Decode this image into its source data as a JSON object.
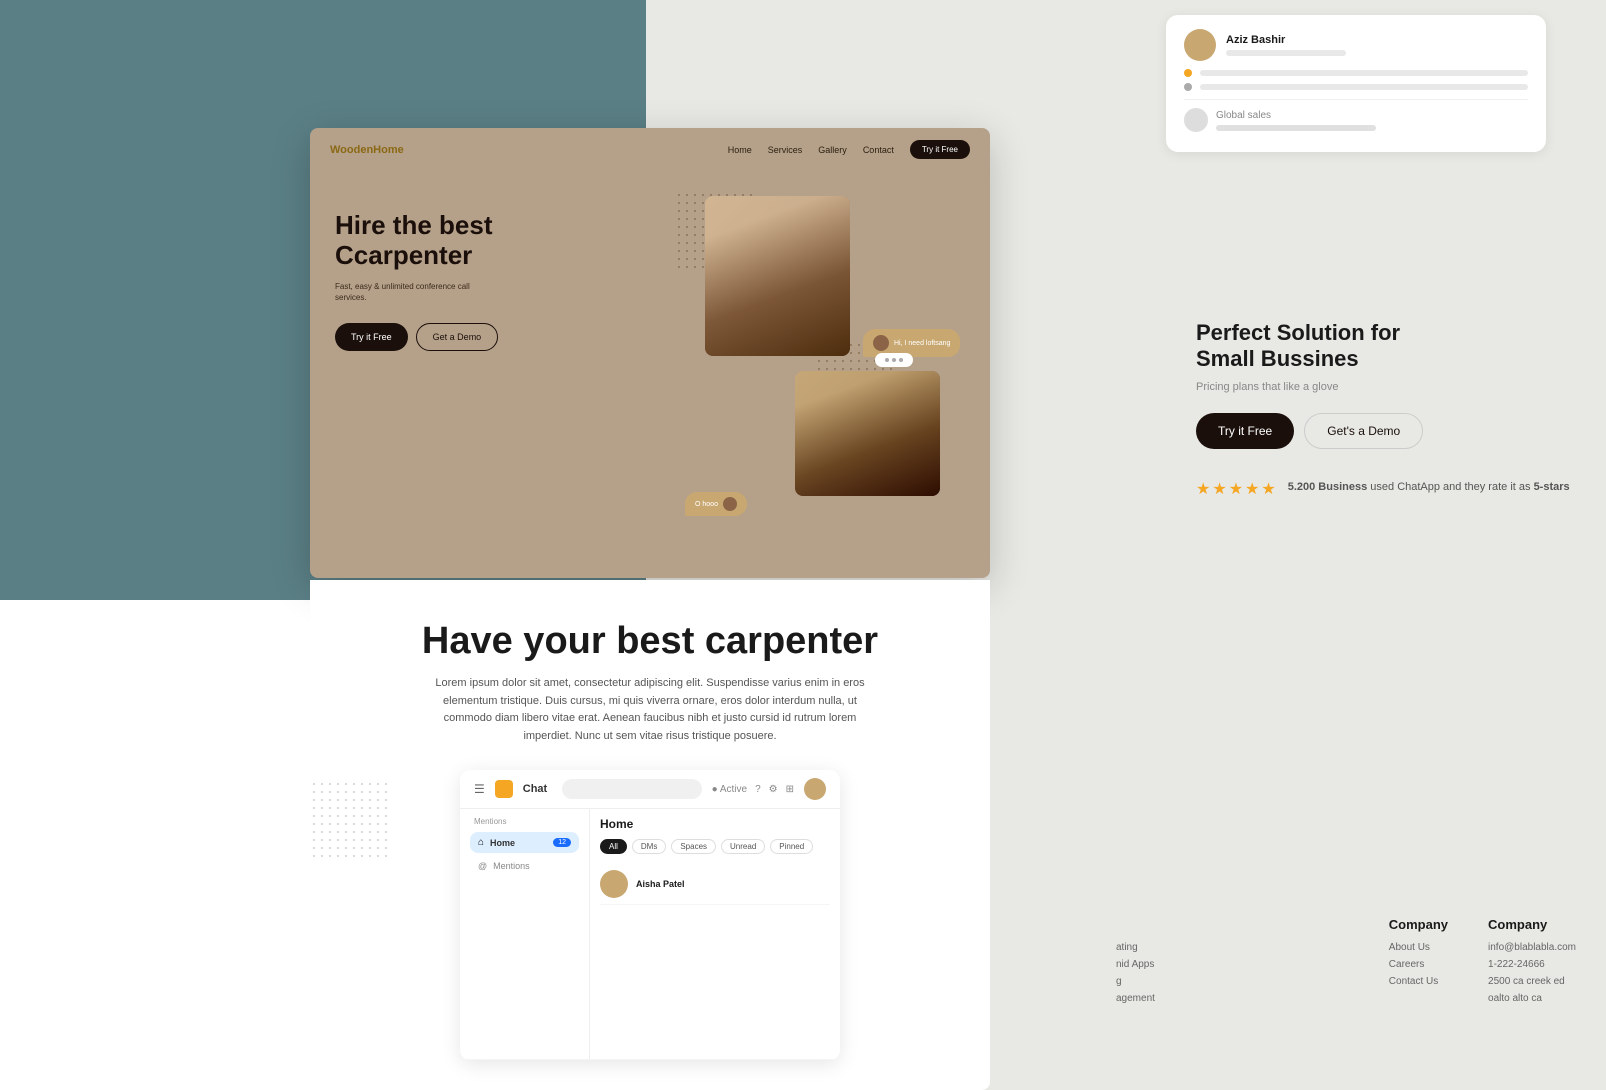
{
  "bg": {
    "teal": "#5a7f85",
    "light": "#e8e8e4",
    "white": "#ffffff"
  },
  "wooden_card": {
    "logo": "WoodenHome",
    "logo_highlight": "Home",
    "nav_links": [
      "Home",
      "Services",
      "Gallery",
      "Contact"
    ],
    "nav_cta": "Try it Free",
    "hero_title_line1": "Hire the best",
    "hero_title_line2": "Ccarpenter",
    "hero_subtitle": "Fast, easy & unlimited conference call services.",
    "cta_primary": "Try it Free",
    "cta_secondary": "Get a Demo",
    "chat_bubble_1": "Hi, I need loftsang",
    "chat_bubble_2": "O hooo"
  },
  "white_section": {
    "title": "Have your best carpenter",
    "description": "Lorem ipsum dolor sit amet, consectetur adipiscing elit. Suspendisse varius enim in eros elementum tristique. Duis cursus, mi quis viverra ornare, eros dolor interdum nulla, ut commodo diam libero vitae erat. Aenean faucibus nibh et justo cursid id rutrum lorem imperdiet. Nunc ut sem vitae risus tristique posuere.",
    "chat_app": {
      "title": "Chat",
      "home_label": "Home",
      "home_badge": "12",
      "mentions_label": "Mentions",
      "filter_tabs": [
        "All",
        "DMs",
        "Spaces",
        "Unread",
        "Pinned"
      ],
      "active_tab": "All",
      "messages": [
        {
          "name": "Aisha Patel"
        }
      ]
    }
  },
  "right_panel": {
    "widget1": {
      "user_name": "Aziz Bashir",
      "global_sales": "Global sales"
    },
    "perfect_solution": {
      "title_line1": "Perfect Solution for",
      "title_line2": "Small Bussines",
      "subtitle": "Pricing plans that like a glove",
      "cta_primary": "Try it Free",
      "cta_secondary": "Get's a Demo"
    },
    "rating": {
      "stars": 5,
      "text_pre": "5.200 Business",
      "text_mid": "used ChatApp and they rate it as",
      "text_bold": "5-stars"
    },
    "footer": {
      "company1": {
        "title": "Company",
        "links": [
          "About Us",
          "Careers",
          "Contact Us"
        ]
      },
      "company2": {
        "title": "Company",
        "links": [
          "info@blablabla.com",
          "1-222-24666",
          "2500 ca creek ed",
          "oalto alto ca"
        ]
      },
      "partial": {
        "links": [
          "ating",
          "nid Apps",
          "g",
          "agement"
        ]
      }
    }
  }
}
